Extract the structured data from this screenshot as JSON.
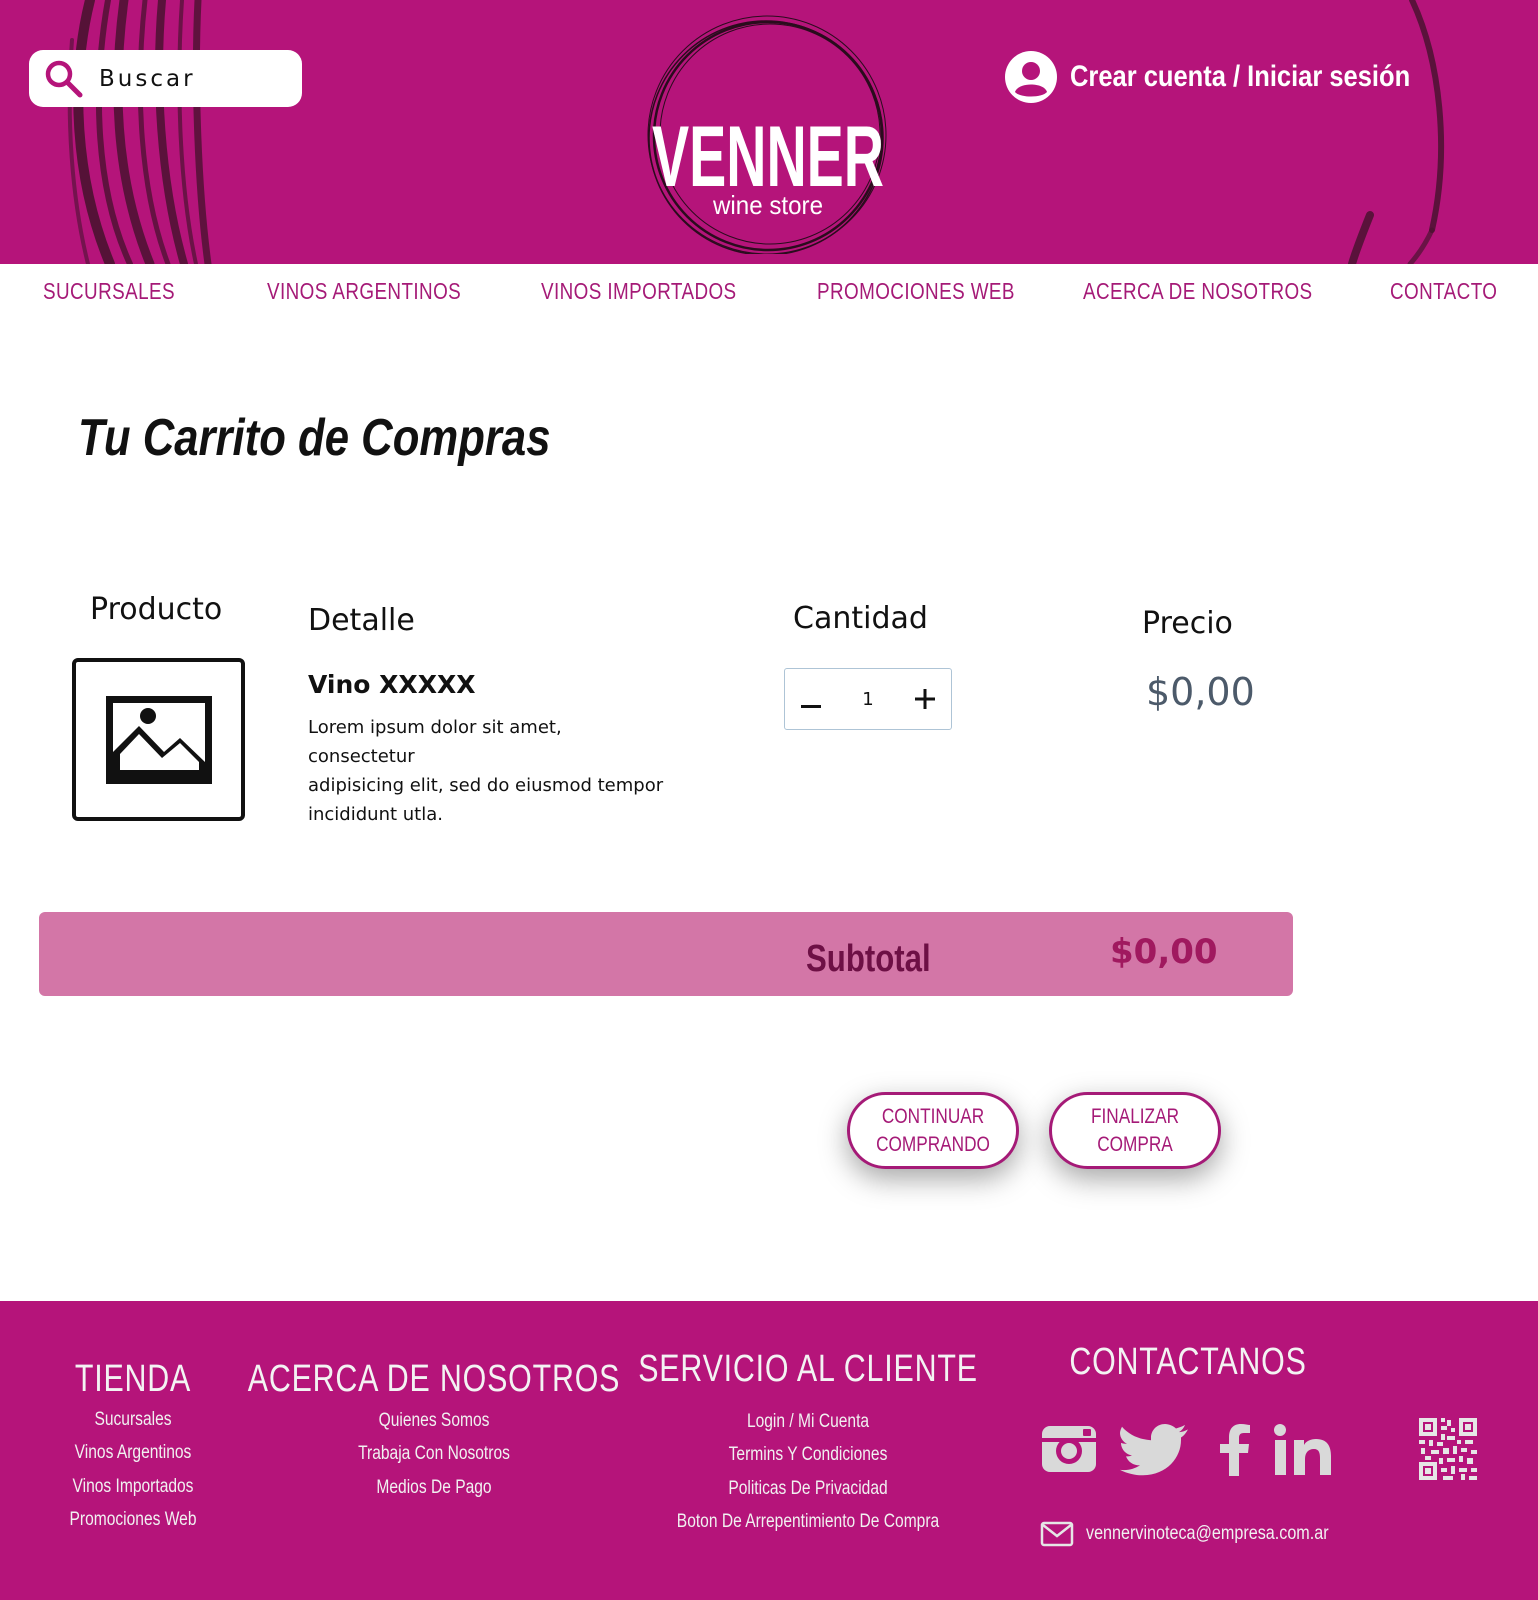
{
  "brand": {
    "name": "VENNER",
    "tagline": "wine store",
    "color": "#b5147a"
  },
  "header": {
    "search_placeholder": "Buscar",
    "account_label": "Crear cuenta / Iniciar sesión"
  },
  "nav": {
    "items": [
      {
        "label": "SUCURSALES"
      },
      {
        "label": "VINOS ARGENTINOS"
      },
      {
        "label": "VINOS IMPORTADOS"
      },
      {
        "label": "PROMOCIONES WEB"
      },
      {
        "label": "ACERCA DE NOSOTROS"
      },
      {
        "label": "CONTACTO"
      }
    ]
  },
  "cart": {
    "title": "Tu Carrito de Compras",
    "columns": {
      "product": "Producto",
      "detail": "Detalle",
      "quantity": "Cantidad",
      "price": "Precio"
    },
    "item": {
      "name": "Vino XXXXX",
      "description_lines": [
        "Lorem ipsum dolor sit amet,",
        "consectetur",
        "adipisicing elit, sed do eiusmod tempor",
        "incididunt utla."
      ],
      "quantity": "1",
      "price": "$0,00"
    },
    "subtotal_label": "Subtotal",
    "subtotal_value": "$0,00",
    "continue_button": "CONTINUAR COMPRANDO",
    "checkout_button": "FINALIZAR COMPRA"
  },
  "footer": {
    "tienda": {
      "title": "TIENDA",
      "links": [
        "Sucursales",
        "Vinos Argentinos",
        "Vinos Importados",
        "Promociones Web"
      ]
    },
    "acerca": {
      "title": "ACERCA DE  NOSOTROS",
      "links": [
        "Quienes Somos",
        "Trabaja Con Nosotros",
        "Medios De Pago"
      ]
    },
    "servicio": {
      "title": "SERVICIO AL CLIENTE",
      "links": [
        "Login / Mi Cuenta",
        "Termins Y Condiciones",
        "Politicas De Privacidad",
        "Boton De Arrepentimiento De Compra"
      ]
    },
    "contacto": {
      "title": "CONTACTANOS",
      "social_icons": [
        "instagram-icon",
        "twitter-icon",
        "facebook-icon",
        "linkedin-icon"
      ],
      "email": "vennervinoteca@empresa.com.ar"
    }
  }
}
